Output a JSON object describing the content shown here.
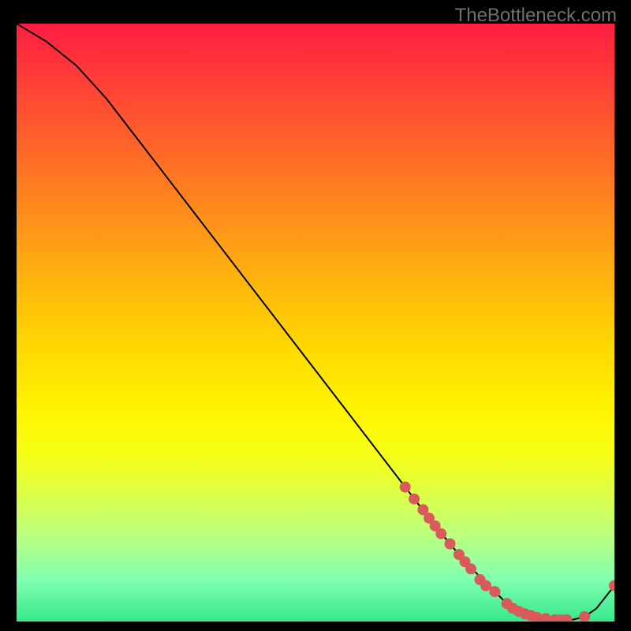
{
  "watermark": "TheBottleneck.com",
  "chart_data": {
    "type": "line",
    "title": "",
    "xlabel": "",
    "ylabel": "",
    "xlim": [
      0,
      100
    ],
    "ylim": [
      0,
      100
    ],
    "series": [
      {
        "name": "bottleneck-curve",
        "x": [
          0,
          5,
          10,
          15,
          20,
          25,
          30,
          35,
          40,
          45,
          50,
          55,
          60,
          65,
          70,
          75,
          80,
          82,
          85,
          88,
          90,
          93,
          95,
          97,
          100
        ],
        "y": [
          100,
          97,
          93,
          87.5,
          81,
          74.5,
          68,
          61.5,
          55,
          48.5,
          42,
          35.5,
          29,
          22.5,
          16,
          10,
          5,
          3,
          1.3,
          0.5,
          0.3,
          0.3,
          0.8,
          2.2,
          6
        ]
      }
    ],
    "markers": [
      {
        "x": 65,
        "y": 22.5
      },
      {
        "x": 66.5,
        "y": 20.5
      },
      {
        "x": 68,
        "y": 18.7
      },
      {
        "x": 69,
        "y": 17.3
      },
      {
        "x": 70,
        "y": 16
      },
      {
        "x": 71,
        "y": 14.7
      },
      {
        "x": 72.5,
        "y": 13
      },
      {
        "x": 74,
        "y": 11.2
      },
      {
        "x": 75,
        "y": 10
      },
      {
        "x": 76,
        "y": 8.8
      },
      {
        "x": 77.5,
        "y": 7
      },
      {
        "x": 78.5,
        "y": 6
      },
      {
        "x": 80,
        "y": 5
      },
      {
        "x": 82,
        "y": 3
      },
      {
        "x": 83,
        "y": 2.2
      },
      {
        "x": 84,
        "y": 1.7
      },
      {
        "x": 85,
        "y": 1.3
      },
      {
        "x": 86,
        "y": 1.0
      },
      {
        "x": 87,
        "y": 0.7
      },
      {
        "x": 88.5,
        "y": 0.5
      },
      {
        "x": 90,
        "y": 0.3
      },
      {
        "x": 91,
        "y": 0.3
      },
      {
        "x": 92,
        "y": 0.3
      },
      {
        "x": 95,
        "y": 0.8
      },
      {
        "x": 100,
        "y": 6
      }
    ],
    "colors": {
      "line": "#000000",
      "marker": "#d85a5a",
      "gradient_top": "#ff1d41",
      "gradient_bottom": "#36e88b"
    }
  }
}
